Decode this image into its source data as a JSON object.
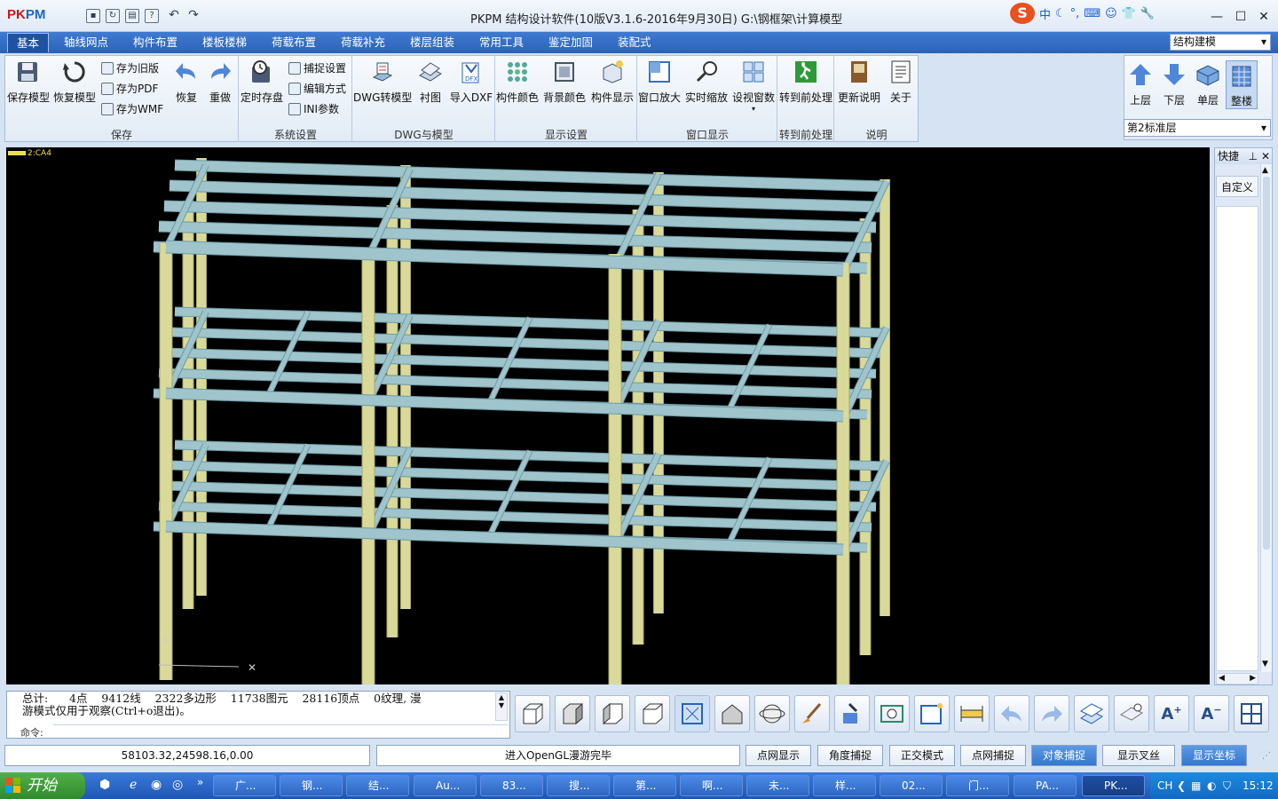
{
  "app": {
    "logo_text": "PKPM",
    "title": "PKPM 结构设计软件(10版V3.1.6-2016年9月30日) G:\\钢框架\\计算模型"
  },
  "window_buttons": {
    "min": "—",
    "max": "☐",
    "close": "✕"
  },
  "ime": {
    "logo": "S",
    "mode": "中"
  },
  "menu": {
    "tabs": [
      "基本",
      "轴线网点",
      "构件布置",
      "楼板楼梯",
      "荷载布置",
      "荷载补充",
      "楼层组装",
      "常用工具",
      "鉴定加固",
      "装配式"
    ],
    "active": "基本",
    "mode_select": "结构建模"
  },
  "ribbon": {
    "groups": [
      {
        "label": "保存",
        "tools": [
          "保存模型",
          "恢复模型"
        ],
        "small": [
          "存为旧版",
          "存为PDF",
          "存为WMF"
        ],
        "extra": [
          "恢复",
          "重做"
        ]
      },
      {
        "label": "系统设置",
        "tools": [
          "定时存盘"
        ],
        "small": [
          "捕捉设置",
          "编辑方式",
          "INI参数"
        ]
      },
      {
        "label": "DWG与模型",
        "tools": [
          "DWG转模型",
          "衬图",
          "导入DXF"
        ]
      },
      {
        "label": "显示设置",
        "tools": [
          "构件颜色",
          "背景颜色",
          "构件显示"
        ]
      },
      {
        "label": "窗口显示",
        "tools": [
          "窗口放大",
          "实时缩放",
          "设视窗数"
        ]
      },
      {
        "label": "转到前处理",
        "tools": [
          "转到前处理"
        ]
      },
      {
        "label": "说明",
        "tools": [
          "更新说明",
          "关于"
        ]
      }
    ]
  },
  "floor_panel": {
    "buttons": [
      "上层",
      "下层",
      "单层",
      "整楼"
    ],
    "active": "整楼",
    "floor_select": "第2标准层"
  },
  "viewport": {
    "tag": "2:CA4"
  },
  "quick_panel": {
    "title": "快捷",
    "custom_label": "自定义"
  },
  "command": {
    "output": "总计:      4点    9412线    2322多边形    11738图元    28116顶点    0纹理, 漫\n游模式仅用于观察(Ctrl+o退出)。",
    "prompt": "命令:"
  },
  "status": {
    "coords": "58103.32,24598.16,0.00",
    "message": "进入OpenGL漫游完毕",
    "toggles": [
      {
        "label": "点网显示",
        "on": false
      },
      {
        "label": "角度捕捉",
        "on": false
      },
      {
        "label": "正交模式",
        "on": false
      },
      {
        "label": "点网捕捉",
        "on": false
      },
      {
        "label": "对象捕捉",
        "on": true
      },
      {
        "label": "显示叉丝",
        "on": false
      },
      {
        "label": "显示坐标",
        "on": true
      }
    ]
  },
  "taskbar": {
    "start": "开始",
    "items": [
      "广...",
      "钢...",
      "结...",
      "Au...",
      "83...",
      "搜...",
      "第...",
      "啊...",
      "未...",
      "样...",
      "02...",
      "门...",
      "PA...",
      "PK..."
    ],
    "active": "PK...",
    "lang": "CH",
    "time": "15:12"
  }
}
